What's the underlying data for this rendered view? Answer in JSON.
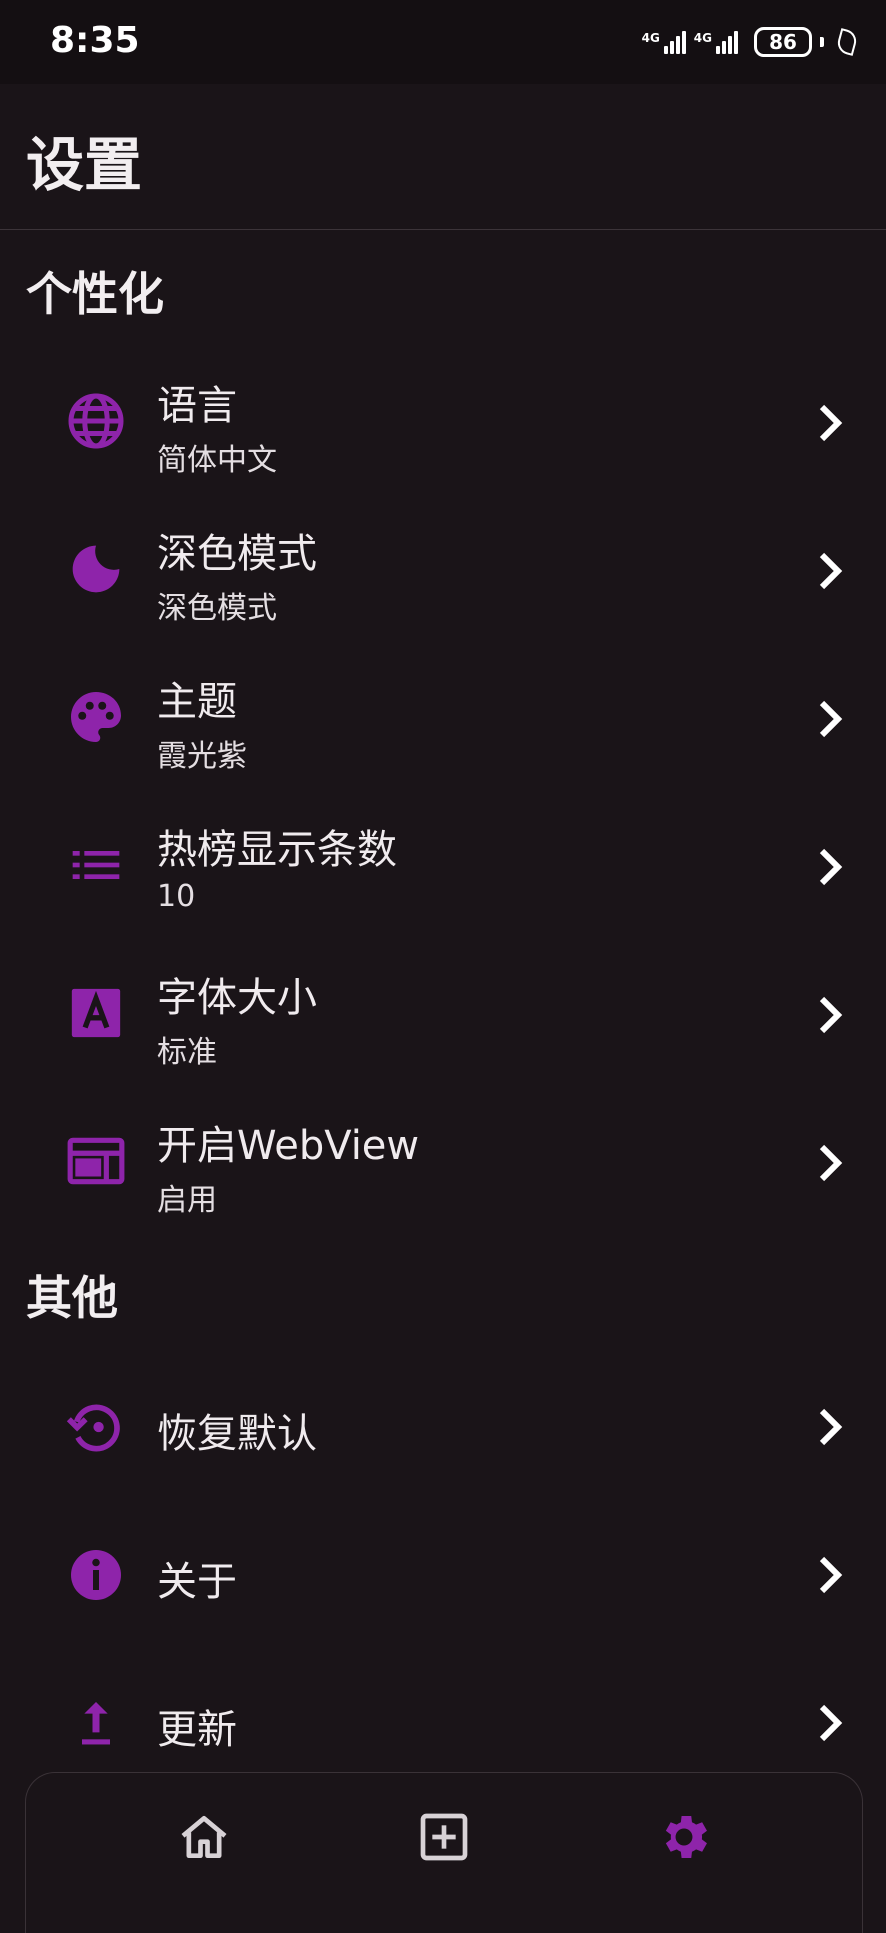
{
  "status_bar": {
    "time": "8:35",
    "signal_1": "4G",
    "signal_2": "4G",
    "battery": "86"
  },
  "page": {
    "title": "设置"
  },
  "colors": {
    "accent": "#8e24aa",
    "background": "#1a1418",
    "text": "#f0ebee"
  },
  "sections": [
    {
      "title": "个性化",
      "items": [
        {
          "icon": "globe-icon",
          "title": "语言",
          "subtitle": "简体中文"
        },
        {
          "icon": "moon-icon",
          "title": "深色模式",
          "subtitle": "深色模式"
        },
        {
          "icon": "palette-icon",
          "title": "主题",
          "subtitle": "霞光紫"
        },
        {
          "icon": "list-icon",
          "title": "热榜显示条数",
          "subtitle": "10"
        },
        {
          "icon": "font-size-icon",
          "title": "字体大小",
          "subtitle": "标准"
        },
        {
          "icon": "webview-icon",
          "title": "开启WebView",
          "subtitle": "启用"
        }
      ]
    },
    {
      "title": "其他",
      "items": [
        {
          "icon": "restore-icon",
          "title": "恢复默认"
        },
        {
          "icon": "info-icon",
          "title": "关于"
        },
        {
          "icon": "upload-icon",
          "title": "更新"
        }
      ]
    }
  ],
  "bottom_nav": [
    {
      "icon": "home-icon",
      "active": false
    },
    {
      "icon": "add-box-icon",
      "active": false
    },
    {
      "icon": "settings-gear-icon",
      "active": true
    }
  ]
}
